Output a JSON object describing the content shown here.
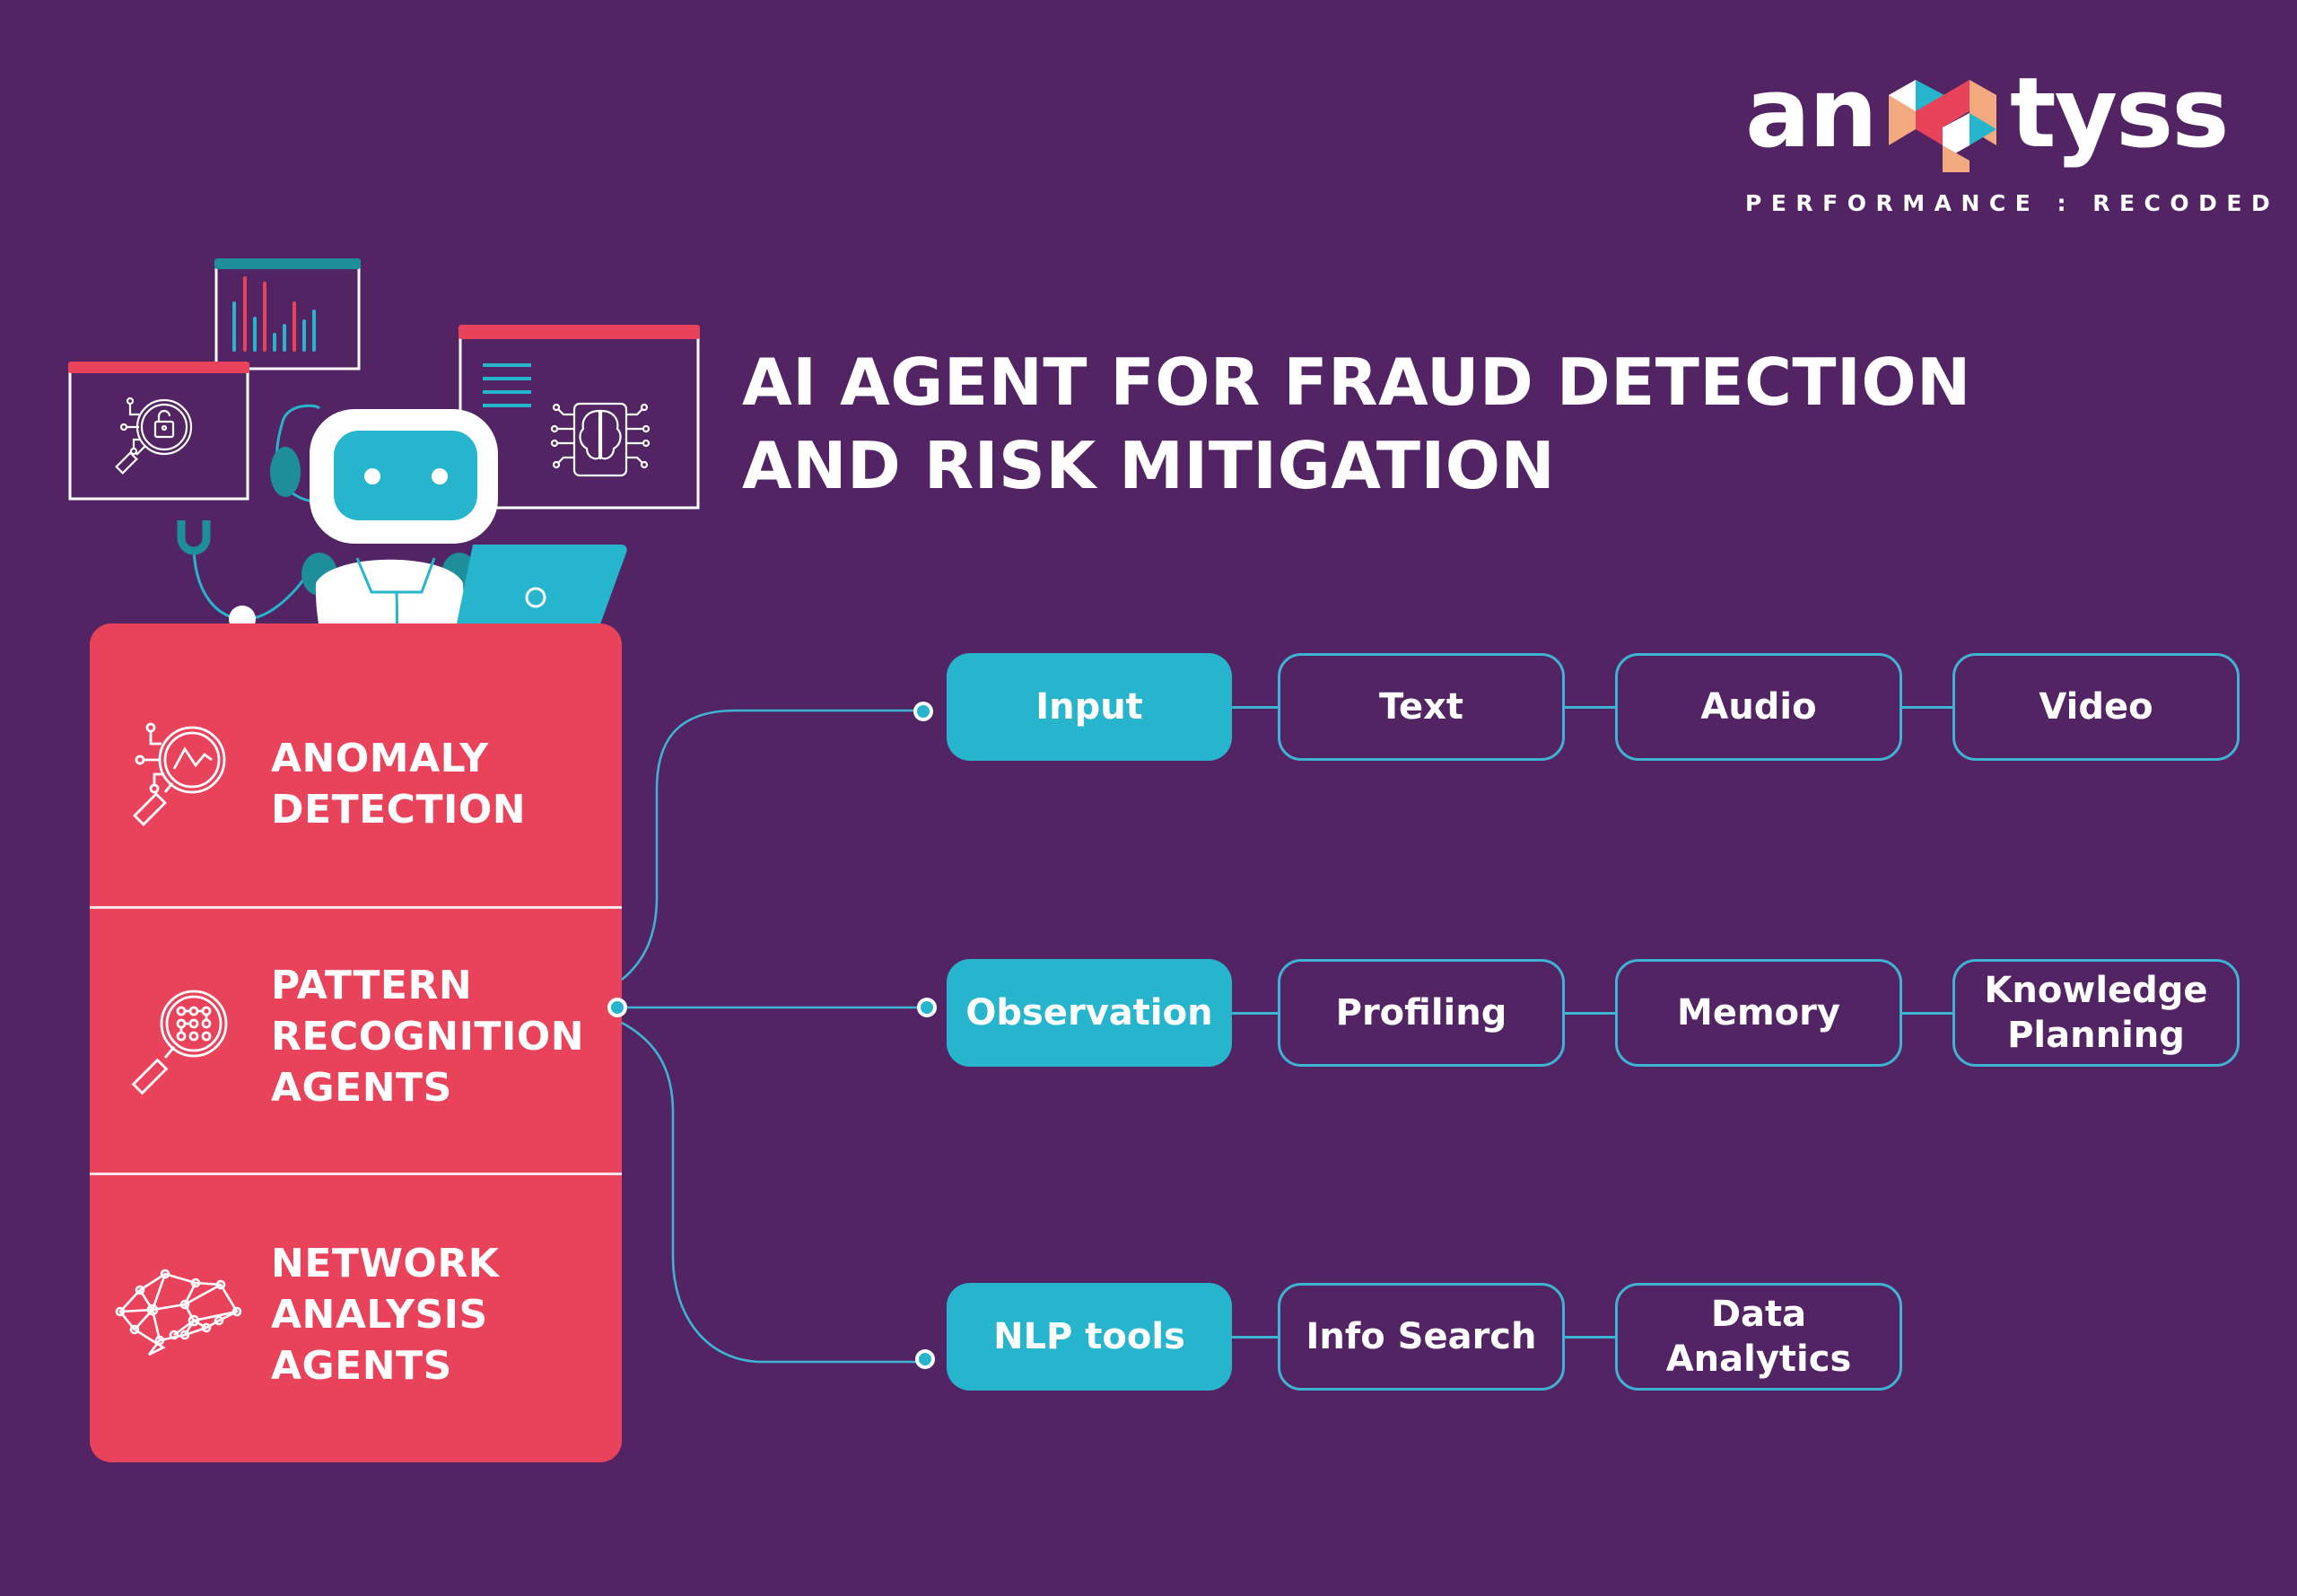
{
  "logo": {
    "word_left": "an",
    "word_right": "tyss",
    "tagline": "PERFORMANCE : RECODED",
    "colors": {
      "teal": "#27B5CE",
      "coral": "#E8435B",
      "peach": "#F2A97E",
      "white": "#FFFFFF"
    }
  },
  "title": {
    "line1": "AI AGENT FOR FRAUD DETECTION",
    "line2": "AND RISK MITIGATION"
  },
  "illustration": {
    "subject": "robot-with-laptop-and-headset",
    "windows": [
      "security-lock-search-window",
      "bar-chart-window",
      "ai-brain-chip-window"
    ]
  },
  "agents_panel": {
    "items": [
      {
        "label": "ANOMALY\nDETECTION",
        "icon": "anomaly-search-icon"
      },
      {
        "label": "PATTERN\nRECOGNITION\nAGENTS",
        "icon": "pattern-search-icon"
      },
      {
        "label": "NETWORK\nANALYSIS\nAGENTS",
        "icon": "network-brain-icon"
      }
    ]
  },
  "flow": {
    "rows": [
      {
        "category": "Input",
        "items": [
          "Text",
          "Audio",
          "Video"
        ]
      },
      {
        "category": "Observation",
        "items": [
          "Profiling",
          "Memory",
          "Knowledge\nPlanning"
        ]
      },
      {
        "category": "NLP tools",
        "items": [
          "Info Search",
          "Data\nAnalytics"
        ]
      }
    ]
  },
  "colors": {
    "background": "#522463",
    "panel": "#E8435B",
    "accent": "#27B5CE",
    "connector": "#3FB3D3",
    "text": "#FFFFFF"
  }
}
